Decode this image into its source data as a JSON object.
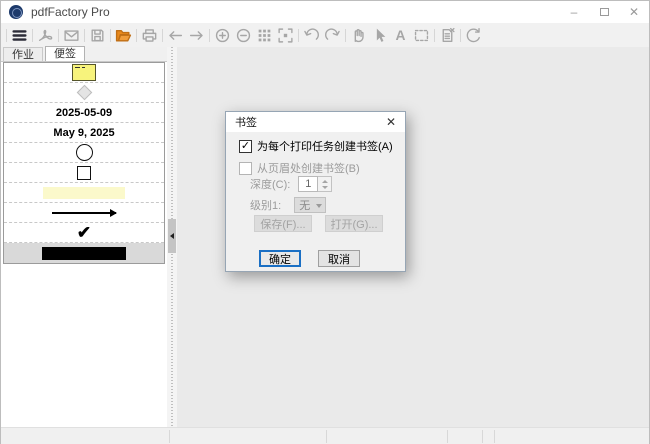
{
  "window": {
    "title": "pdfFactory Pro",
    "controls": {
      "minimize_glyph": "–",
      "close_glyph": "✕"
    }
  },
  "toolbar": {
    "items": [
      "|",
      "menu",
      "|",
      "acrobat",
      "|",
      "mail",
      "|",
      "save",
      "|",
      "open-folder",
      "|",
      "print",
      "|",
      "arrow-left",
      "arrow-right",
      "|",
      "zoom-in",
      "zoom-out",
      "grid",
      "fit-page",
      "|",
      "undo",
      "redo",
      "|",
      "hand",
      "cursor",
      "text",
      "marquee",
      "|",
      "delete-page",
      "|",
      "refresh"
    ]
  },
  "sidebar": {
    "tabs": [
      {
        "id": "job",
        "label": "作业",
        "active": false
      },
      {
        "id": "notes",
        "label": "便签",
        "active": true
      }
    ],
    "note_items": [
      {
        "type": "sticky-note"
      },
      {
        "type": "diamond"
      },
      {
        "type": "text",
        "label": "2025-05-09"
      },
      {
        "type": "text",
        "label": "May 9, 2025"
      },
      {
        "type": "circle"
      },
      {
        "type": "square"
      },
      {
        "type": "highlight"
      },
      {
        "type": "arrow"
      },
      {
        "type": "checkmark",
        "glyph": "✔"
      },
      {
        "type": "blackout",
        "selected": true
      }
    ]
  },
  "dialog": {
    "title": "书签",
    "close_glyph": "✕",
    "create_per_job": {
      "label": "为每个打印任务创建书签(A)",
      "checked": true,
      "check_glyph": "✓"
    },
    "from_heading": {
      "label": "从页眉处创建书签(B)",
      "checked": false
    },
    "depth": {
      "label": "深度(C):",
      "value": "1"
    },
    "level": {
      "label": "级别1:",
      "value": "无"
    },
    "buttons": {
      "save": "保存(F)...",
      "open": "打开(G)...",
      "ok": "确定",
      "cancel": "取消"
    }
  },
  "colors": {
    "accent": "#1a6fc4",
    "folder_orange": "#e8891d",
    "sticky_yellow": "#f7f37c",
    "highlight_yellow": "#fbf9cb",
    "toolbar_icon_gray": "#a6a6a6",
    "main_canvas_gray": "#eaeaea"
  }
}
